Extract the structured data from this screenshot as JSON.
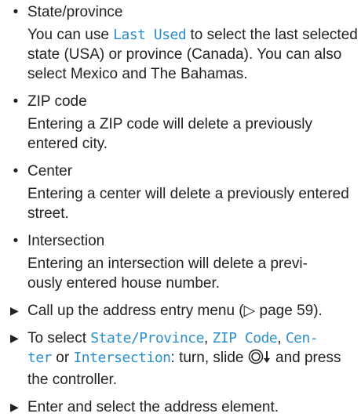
{
  "items": [
    {
      "heading": "State/province",
      "desc_before": "You can use ",
      "desc_highlight": "Last Used",
      "desc_after": " to select the last selected state (USA) or province (Canada). You can also select Mexico and The Bahamas."
    },
    {
      "heading": "ZIP code",
      "desc": "Entering a ZIP code will delete a previously entered city."
    },
    {
      "heading": "Center",
      "desc": "Entering a center will delete a previously entered street."
    },
    {
      "heading": "Intersection",
      "desc": "Entering an intersection will delete a previ-ously entered house number."
    }
  ],
  "steps": {
    "call_up": "Call up the address entry menu (▷ page 59).",
    "select_prefix": "To select ",
    "opt_state": "State/Province",
    "sep1": ", ",
    "opt_zip": "ZIP Code",
    "sep2": ", ",
    "opt_center_a": "Cen-",
    "opt_center_b": "ter",
    "or": " or ",
    "opt_intersection": "Intersection",
    "select_suffix": ": turn, slide ",
    "select_end": " and press the controller.",
    "enter": "Enter and select the address element."
  },
  "colors": {
    "highlight": "#2b8fc9",
    "text": "#222222"
  },
  "bullet_char": "•",
  "arrow_char": "▶"
}
